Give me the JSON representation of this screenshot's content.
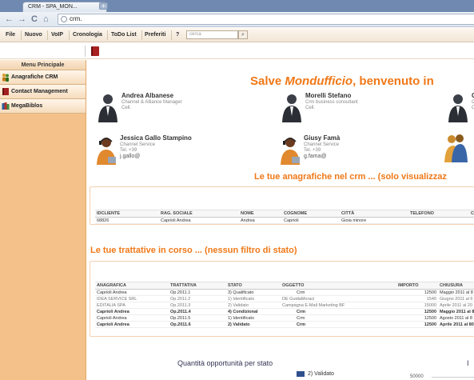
{
  "browser": {
    "tab_title": "CRM - SPA_MON...",
    "tab_close": "×",
    "url": "crm.",
    "nav": {
      "back": "←",
      "forward": "→",
      "reload": "C",
      "home": "⌂"
    }
  },
  "menubar": {
    "items": [
      "File",
      "Nuovo",
      "VoIP",
      "Cronologia",
      "ToDo List",
      "Preferiti",
      "?"
    ],
    "search_placeholder": "cerca",
    "search_button": "⌕"
  },
  "sidebar": {
    "header": "Menu Principale",
    "items": [
      {
        "label": "Anagrafiche CRM",
        "icon": "people-icon"
      },
      {
        "label": "Contact Management",
        "icon": "book-icon"
      },
      {
        "label": "MegaBiblos",
        "icon": "books-icon"
      }
    ]
  },
  "welcome": {
    "prefix": "Salve ",
    "name": "Mondufficio",
    "suffix": ", benvenuto in"
  },
  "contacts": [
    {
      "name": "Andrea Albanese",
      "role": "Channel & Alliance Manager",
      "phone": "Cell.",
      "email": "",
      "avatar": "businessman-avatar"
    },
    {
      "name": "Morelli Stefano",
      "role": "Crm business consultant",
      "phone": "Cell.",
      "email": "",
      "avatar": "businessman-avatar"
    },
    {
      "name": "G",
      "role": "C",
      "phone": "C",
      "email": "",
      "avatar": "businessman-avatar"
    },
    {
      "name": "Jessica Gallo Stampino",
      "role": "Channel Service",
      "phone": "Tel. +39",
      "email": "j.gallo@",
      "avatar": "operator-avatar"
    },
    {
      "name": "Giusy Famà",
      "role": "Channel Service",
      "phone": "Tel. +39",
      "email": "g.fama@",
      "avatar": "operator-avatar"
    },
    {
      "name": "",
      "role": "",
      "phone": "",
      "email": "",
      "avatar": "team-avatar"
    }
  ],
  "anagrafiche": {
    "title": "Le tue anagrafiche nel crm ... (solo visualizzaz",
    "columns": [
      "IDCLIENTE",
      "RAG. SOCIALE",
      "NOME",
      "COGNOME",
      "CITTÀ",
      "TELEFONO",
      "CE"
    ],
    "rows": [
      [
        "68826",
        "Caprioli Andrea",
        "Andrea",
        "Caprioli",
        "Gioia minore",
        "",
        ""
      ]
    ]
  },
  "trattative": {
    "title": "Le tue trattative in corso ... (nessun filtro di stato)",
    "columns": [
      "ANAGRAFICA",
      "TRATTATIVA",
      "STATO",
      "OGGETTO",
      "IMPORTO",
      "CHIUSURA"
    ],
    "rows": [
      {
        "cells": [
          "Caprioli Andrea",
          "Op.2011.1",
          "3) Qualificato",
          "Crm",
          "12500",
          "Maggio 2011 al 8"
        ],
        "style": "normal"
      },
      {
        "cells": [
          "IDEA SERVICE SRL",
          "Op.2011.2",
          "1) Identificato",
          "DE GuidaMoraci",
          "1540",
          "Giugno 2011 al 6"
        ],
        "style": "grey"
      },
      {
        "cells": [
          "EDITALIA SPA",
          "Op.2011.3",
          "2) Validato",
          "Campagna E-Mail Marketing BF",
          "15000",
          "Aprile 2011 al 20"
        ],
        "style": "grey"
      },
      {
        "cells": [
          "Caprioli Andrea",
          "Op.2011.4",
          "4) Condizional",
          "Crm",
          "12500",
          "Maggio 2011 al 8"
        ],
        "style": "bold"
      },
      {
        "cells": [
          "Caprioli Andrea",
          "Op.2011.5",
          "1) Identificato",
          "Crm",
          "12500",
          "Agosto 2011 al 8"
        ],
        "style": "normal"
      },
      {
        "cells": [
          "Caprioli Andrea",
          "Op.2011.6",
          "2) Validato",
          "Crm",
          "12500",
          "Aprile 2011 al 80"
        ],
        "style": "bold"
      }
    ]
  },
  "chart": {
    "title": "Quantità opportunità per stato",
    "legend": "2) Validato",
    "right_title": "I",
    "axis_value": "50000",
    "colors": {
      "series": "#2f4f8f"
    }
  }
}
